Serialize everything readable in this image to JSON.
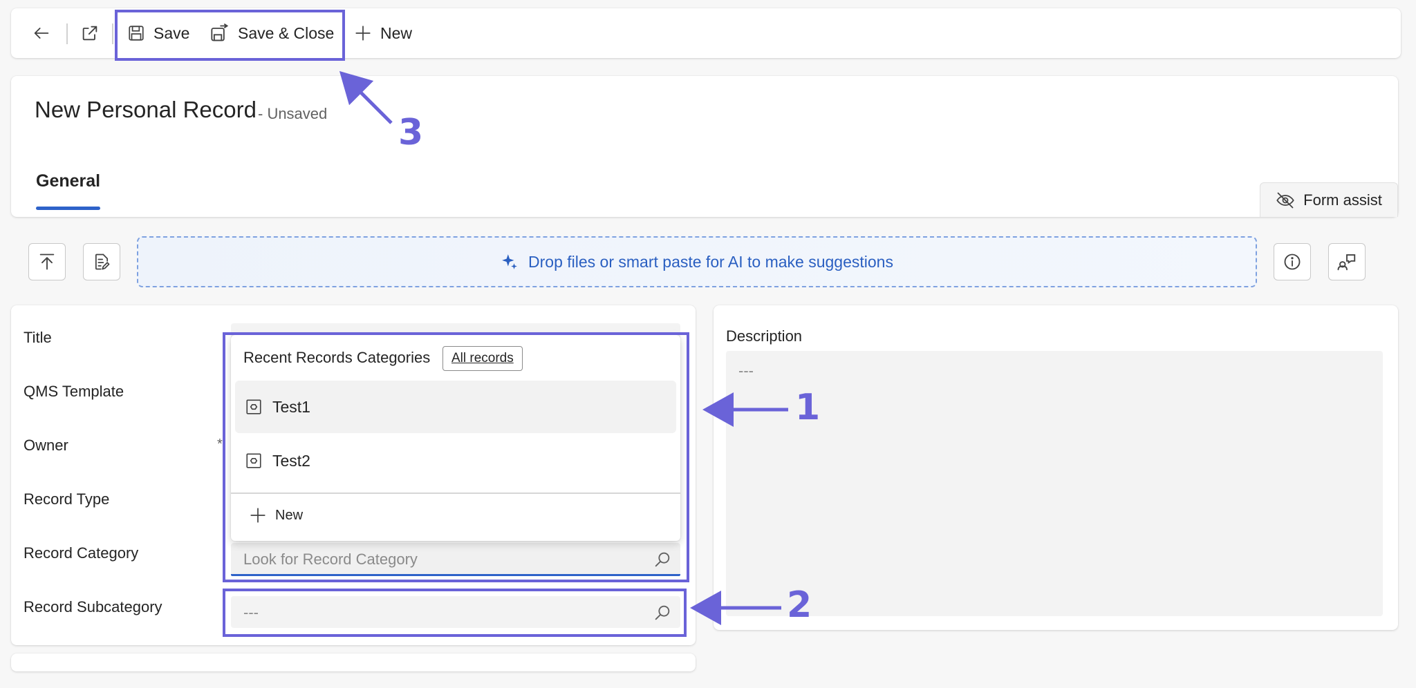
{
  "commandbar": {
    "save_label": "Save",
    "save_close_label": "Save & Close",
    "new_label": "New"
  },
  "header": {
    "title": "New Personal Record",
    "status": "- Unsaved",
    "tab_general": "General",
    "form_assist_label": "Form assist"
  },
  "dropzone": {
    "text": "Drop files or smart paste for AI to make suggestions"
  },
  "form": {
    "labels": {
      "title": "Title",
      "qms_template": "QMS Template",
      "owner": "Owner",
      "record_type": "Record Type",
      "record_category": "Record Category",
      "record_subcategory": "Record Subcategory"
    },
    "required_mark": "*",
    "record_category_placeholder": "Look for Record Category",
    "record_subcategory_value": "---"
  },
  "dropdown": {
    "header": "Recent Records Categories",
    "all_records_label": "All records",
    "items": [
      {
        "label": "Test1"
      },
      {
        "label": "Test2"
      }
    ],
    "new_label": "New"
  },
  "description": {
    "label": "Description",
    "value": "---"
  },
  "annotations": {
    "one": "1",
    "two": "2",
    "three": "3",
    "color": "#6a63d8"
  },
  "colors": {
    "accent": "#2e62c9",
    "annotation": "#6a63d8"
  },
  "icons": [
    "back-arrow-icon",
    "open-in-new-window-icon",
    "save-icon",
    "save-close-icon",
    "plus-icon",
    "eye-off-icon",
    "upload-top-icon",
    "document-edit-icon",
    "sparkle-icon",
    "info-icon",
    "feedback-icon",
    "search-icon",
    "entity-icon"
  ]
}
